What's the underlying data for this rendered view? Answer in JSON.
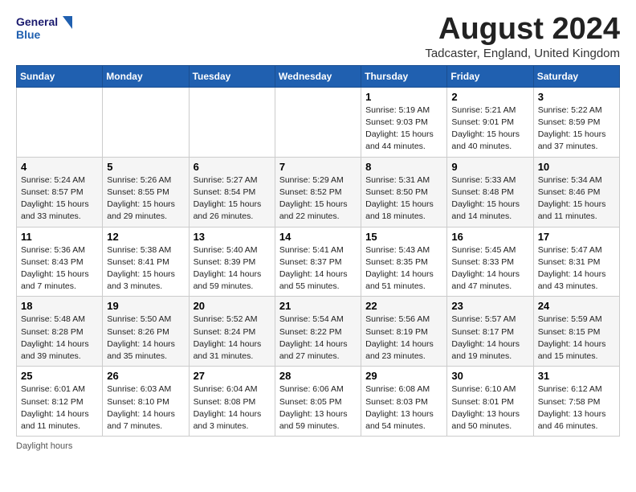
{
  "header": {
    "logo_line1": "General",
    "logo_line2": "Blue",
    "month": "August 2024",
    "location": "Tadcaster, England, United Kingdom"
  },
  "weekdays": [
    "Sunday",
    "Monday",
    "Tuesday",
    "Wednesday",
    "Thursday",
    "Friday",
    "Saturday"
  ],
  "weeks": [
    [
      {
        "day": "",
        "info": ""
      },
      {
        "day": "",
        "info": ""
      },
      {
        "day": "",
        "info": ""
      },
      {
        "day": "",
        "info": ""
      },
      {
        "day": "1",
        "info": "Sunrise: 5:19 AM\nSunset: 9:03 PM\nDaylight: 15 hours\nand 44 minutes."
      },
      {
        "day": "2",
        "info": "Sunrise: 5:21 AM\nSunset: 9:01 PM\nDaylight: 15 hours\nand 40 minutes."
      },
      {
        "day": "3",
        "info": "Sunrise: 5:22 AM\nSunset: 8:59 PM\nDaylight: 15 hours\nand 37 minutes."
      }
    ],
    [
      {
        "day": "4",
        "info": "Sunrise: 5:24 AM\nSunset: 8:57 PM\nDaylight: 15 hours\nand 33 minutes."
      },
      {
        "day": "5",
        "info": "Sunrise: 5:26 AM\nSunset: 8:55 PM\nDaylight: 15 hours\nand 29 minutes."
      },
      {
        "day": "6",
        "info": "Sunrise: 5:27 AM\nSunset: 8:54 PM\nDaylight: 15 hours\nand 26 minutes."
      },
      {
        "day": "7",
        "info": "Sunrise: 5:29 AM\nSunset: 8:52 PM\nDaylight: 15 hours\nand 22 minutes."
      },
      {
        "day": "8",
        "info": "Sunrise: 5:31 AM\nSunset: 8:50 PM\nDaylight: 15 hours\nand 18 minutes."
      },
      {
        "day": "9",
        "info": "Sunrise: 5:33 AM\nSunset: 8:48 PM\nDaylight: 15 hours\nand 14 minutes."
      },
      {
        "day": "10",
        "info": "Sunrise: 5:34 AM\nSunset: 8:46 PM\nDaylight: 15 hours\nand 11 minutes."
      }
    ],
    [
      {
        "day": "11",
        "info": "Sunrise: 5:36 AM\nSunset: 8:43 PM\nDaylight: 15 hours\nand 7 minutes."
      },
      {
        "day": "12",
        "info": "Sunrise: 5:38 AM\nSunset: 8:41 PM\nDaylight: 15 hours\nand 3 minutes."
      },
      {
        "day": "13",
        "info": "Sunrise: 5:40 AM\nSunset: 8:39 PM\nDaylight: 14 hours\nand 59 minutes."
      },
      {
        "day": "14",
        "info": "Sunrise: 5:41 AM\nSunset: 8:37 PM\nDaylight: 14 hours\nand 55 minutes."
      },
      {
        "day": "15",
        "info": "Sunrise: 5:43 AM\nSunset: 8:35 PM\nDaylight: 14 hours\nand 51 minutes."
      },
      {
        "day": "16",
        "info": "Sunrise: 5:45 AM\nSunset: 8:33 PM\nDaylight: 14 hours\nand 47 minutes."
      },
      {
        "day": "17",
        "info": "Sunrise: 5:47 AM\nSunset: 8:31 PM\nDaylight: 14 hours\nand 43 minutes."
      }
    ],
    [
      {
        "day": "18",
        "info": "Sunrise: 5:48 AM\nSunset: 8:28 PM\nDaylight: 14 hours\nand 39 minutes."
      },
      {
        "day": "19",
        "info": "Sunrise: 5:50 AM\nSunset: 8:26 PM\nDaylight: 14 hours\nand 35 minutes."
      },
      {
        "day": "20",
        "info": "Sunrise: 5:52 AM\nSunset: 8:24 PM\nDaylight: 14 hours\nand 31 minutes."
      },
      {
        "day": "21",
        "info": "Sunrise: 5:54 AM\nSunset: 8:22 PM\nDaylight: 14 hours\nand 27 minutes."
      },
      {
        "day": "22",
        "info": "Sunrise: 5:56 AM\nSunset: 8:19 PM\nDaylight: 14 hours\nand 23 minutes."
      },
      {
        "day": "23",
        "info": "Sunrise: 5:57 AM\nSunset: 8:17 PM\nDaylight: 14 hours\nand 19 minutes."
      },
      {
        "day": "24",
        "info": "Sunrise: 5:59 AM\nSunset: 8:15 PM\nDaylight: 14 hours\nand 15 minutes."
      }
    ],
    [
      {
        "day": "25",
        "info": "Sunrise: 6:01 AM\nSunset: 8:12 PM\nDaylight: 14 hours\nand 11 minutes."
      },
      {
        "day": "26",
        "info": "Sunrise: 6:03 AM\nSunset: 8:10 PM\nDaylight: 14 hours\nand 7 minutes."
      },
      {
        "day": "27",
        "info": "Sunrise: 6:04 AM\nSunset: 8:08 PM\nDaylight: 14 hours\nand 3 minutes."
      },
      {
        "day": "28",
        "info": "Sunrise: 6:06 AM\nSunset: 8:05 PM\nDaylight: 13 hours\nand 59 minutes."
      },
      {
        "day": "29",
        "info": "Sunrise: 6:08 AM\nSunset: 8:03 PM\nDaylight: 13 hours\nand 54 minutes."
      },
      {
        "day": "30",
        "info": "Sunrise: 6:10 AM\nSunset: 8:01 PM\nDaylight: 13 hours\nand 50 minutes."
      },
      {
        "day": "31",
        "info": "Sunrise: 6:12 AM\nSunset: 7:58 PM\nDaylight: 13 hours\nand 46 minutes."
      }
    ]
  ],
  "footer": {
    "daylight_label": "Daylight hours"
  }
}
